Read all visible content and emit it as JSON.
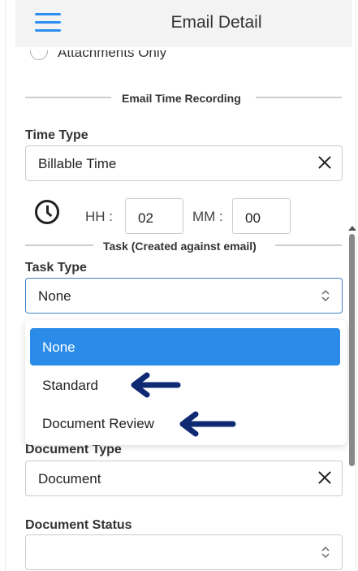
{
  "header": {
    "title": "Email Detail"
  },
  "radio": {
    "label": "Attachments Only"
  },
  "section_time": {
    "title": "Email Time Recording"
  },
  "time_type": {
    "label": "Time Type",
    "value": "Billable Time"
  },
  "time": {
    "hh_label": "HH :",
    "hh_value": "02",
    "mm_label": "MM :",
    "mm_value": "00"
  },
  "section_task": {
    "title": "Task (Created against email)"
  },
  "task_type": {
    "label": "Task Type",
    "value": "None",
    "options": [
      "None",
      "Standard",
      "Document Review"
    ]
  },
  "document_type": {
    "label": "Document Type",
    "value": "Document"
  },
  "document_status": {
    "label": "Document Status",
    "value": ""
  },
  "colors": {
    "accent": "#2b8be8",
    "arrow": "#0f2a73"
  }
}
